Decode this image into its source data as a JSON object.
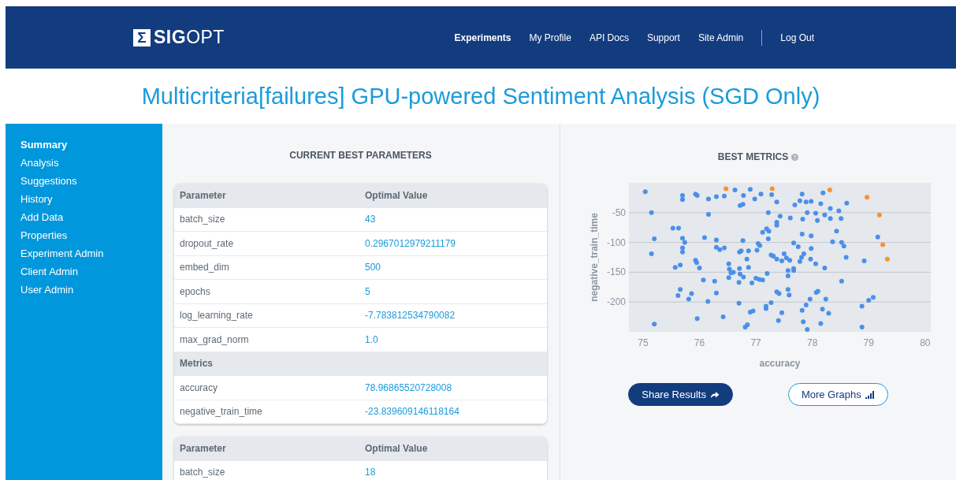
{
  "header": {
    "logo_mark": "Σ",
    "logo_text_bold": "SIG",
    "logo_text_light": "OPT",
    "nav": [
      {
        "label": "Experiments",
        "selected": true
      },
      {
        "label": "My Profile",
        "selected": false
      },
      {
        "label": "API Docs",
        "selected": false
      },
      {
        "label": "Support",
        "selected": false
      },
      {
        "label": "Site Admin",
        "selected": false
      }
    ],
    "logout": "Log Out"
  },
  "title": "Multicriteria[failures] GPU-powered Sentiment Analysis (SGD Only)",
  "sidebar": {
    "items": [
      {
        "label": "Summary",
        "selected": true
      },
      {
        "label": "Analysis",
        "selected": false
      },
      {
        "label": "Suggestions",
        "selected": false
      },
      {
        "label": "History",
        "selected": false
      },
      {
        "label": "Add Data",
        "selected": false
      },
      {
        "label": "Properties",
        "selected": false
      },
      {
        "label": "Experiment Admin",
        "selected": false
      },
      {
        "label": "Client Admin",
        "selected": false
      },
      {
        "label": "User Admin",
        "selected": false
      }
    ]
  },
  "parameters_panel": {
    "heading": "CURRENT BEST PARAMETERS",
    "tables": [
      {
        "rows": [
          {
            "kind": "header",
            "name": "Parameter",
            "value": "Optimal Value"
          },
          {
            "kind": "row",
            "name": "batch_size",
            "value": "43"
          },
          {
            "kind": "row",
            "name": "dropout_rate",
            "value": "0.2967012979211179"
          },
          {
            "kind": "row",
            "name": "embed_dim",
            "value": "500"
          },
          {
            "kind": "row",
            "name": "epochs",
            "value": "5"
          },
          {
            "kind": "row",
            "name": "log_learning_rate",
            "value": "-7.783812534790082"
          },
          {
            "kind": "row",
            "name": "max_grad_norm",
            "value": "1.0"
          },
          {
            "kind": "section",
            "name": "Metrics"
          },
          {
            "kind": "row",
            "name": "accuracy",
            "value": "78.96865520728008"
          },
          {
            "kind": "row",
            "name": "negative_train_time",
            "value": "-23.839609146118164"
          }
        ]
      },
      {
        "rows": [
          {
            "kind": "header",
            "name": "Parameter",
            "value": "Optimal Value"
          },
          {
            "kind": "row",
            "name": "batch_size",
            "value": "18"
          }
        ]
      }
    ]
  },
  "metrics_panel": {
    "heading": "BEST METRICS",
    "chart_data": {
      "type": "scatter",
      "xlabel": "accuracy",
      "ylabel": "negative_train_time",
      "xlim": [
        74.75,
        80.1
      ],
      "ylim": [
        -250,
        0
      ],
      "xticks": [
        75,
        76,
        77,
        78,
        79,
        80
      ],
      "yticks": [
        -50,
        -100,
        -150,
        -200
      ],
      "grid": true,
      "series": [
        {
          "color": "#4a90e8",
          "x": [
            75.04,
            75.15,
            75.2,
            75.15,
            75.2,
            75.53,
            75.63,
            75.7,
            75.7,
            75.7,
            75.74,
            75.7,
            75.7,
            75.57,
            75.66,
            75.62,
            75.66,
            75.81,
            75.86,
            75.93,
            75.96,
            75.93,
            75.95,
            76.0,
            75.96,
            76.16,
            76.16,
            76.09,
            76.07,
            76.15,
            76.3,
            76.3,
            76.3,
            76.36,
            76.44,
            76.27,
            76.3,
            76.42,
            76.44,
            76.63,
            76.78,
            76.72,
            76.77,
            76.77,
            76.9,
            76.98,
            77.09,
            76.52,
            76.53,
            76.56,
            76.6,
            76.52,
            76.71,
            76.74,
            76.71,
            76.72,
            76.78,
            76.7,
            76.7,
            76.84,
            76.87,
            76.87,
            76.93,
            76.9,
            76.95,
            76.81,
            76.85,
            77.02,
            77.04,
            77.07,
            77.0,
            77.06,
            77.12,
            77.12,
            77.19,
            77.23,
            77.22,
            77.22,
            77.28,
            77.2,
            77.18,
            77.18,
            77.27,
            77.27,
            77.31,
            77.37,
            77.46,
            77.37,
            77.37,
            77.37,
            77.43,
            77.5,
            77.54,
            77.6,
            77.37,
            77.41,
            77.57,
            77.57,
            77.57,
            77.59,
            77.46,
            77.4,
            77.61,
            77.69,
            77.67,
            77.75,
            77.67,
            77.67,
            77.78,
            77.81,
            77.85,
            77.78,
            77.82,
            77.89,
            77.98,
            77.83,
            77.91,
            77.82,
            77.98,
            77.98,
            77.97,
            77.82,
            77.84,
            77.89,
            77.96,
            77.91,
            78.06,
            78.09,
            78.06,
            78.07,
            78.1,
            78.19,
            78.15,
            78.22,
            78.32,
            78.32,
            78.36,
            78.22,
            78.24,
            78.18,
            78.29,
            78.15,
            78.43,
            78.47,
            78.51,
            78.52,
            78.56,
            78.61,
            78.6,
            78.52,
            78.92,
            79.16,
            78.88,
            79.0,
            79.08,
            78.88
          ],
          "values": [
            -15,
            -50,
            -94,
            -119,
            -237,
            -76,
            -76,
            -21,
            -28,
            -93,
            -100,
            -109,
            -116,
            -142,
            -138,
            -189,
            -179,
            -195,
            -186,
            -19,
            -21,
            -130,
            -134,
            -143,
            -228,
            -27,
            -53,
            -92,
            -163,
            -199,
            -23,
            -96,
            -108,
            -112,
            -109,
            -165,
            -185,
            -225,
            -22,
            -12,
            -21,
            -38,
            -36,
            -97,
            -11,
            -27,
            -19,
            -136,
            -145,
            -151,
            -150,
            -159,
            -116,
            -114,
            -144,
            -153,
            -158,
            -167,
            -202,
            -128,
            -142,
            -114,
            -168,
            -217,
            -215,
            -242,
            -238,
            -113,
            -102,
            -105,
            -160,
            -162,
            -163,
            -83,
            -77,
            -81,
            -94,
            -50,
            -20,
            -152,
            -207,
            -211,
            -201,
            -121,
            -123,
            -128,
            -131,
            -32,
            -66,
            -71,
            -56,
            -119,
            -126,
            -130,
            -183,
            -186,
            -147,
            -156,
            -179,
            -188,
            -218,
            -231,
            -59,
            -37,
            -101,
            -107,
            -144,
            -147,
            -132,
            -125,
            -119,
            -30,
            -19,
            -32,
            -31,
            -61,
            -50,
            -86,
            -89,
            -110,
            -128,
            -214,
            -233,
            -205,
            -195,
            -246,
            -51,
            -63,
            -136,
            -184,
            -182,
            -17,
            -35,
            -54,
            -43,
            -60,
            -99,
            -143,
            -195,
            -212,
            -219,
            -236,
            -81,
            -47,
            -60,
            -100,
            -106,
            -34,
            -125,
            -165,
            -131,
            -91,
            -207,
            -197,
            -192,
            -242
          ]
        },
        {
          "color": "#f7922f",
          "x": [
            76.47,
            77.29,
            78.31,
            78.97,
            79.19,
            79.25,
            79.33
          ],
          "values": [
            -10,
            -10,
            -12,
            -24,
            -54,
            -104,
            -128
          ]
        }
      ]
    },
    "buttons": [
      {
        "label": "Share Results",
        "kind": "primary"
      },
      {
        "label": "More Graphs",
        "kind": "outline"
      }
    ]
  }
}
